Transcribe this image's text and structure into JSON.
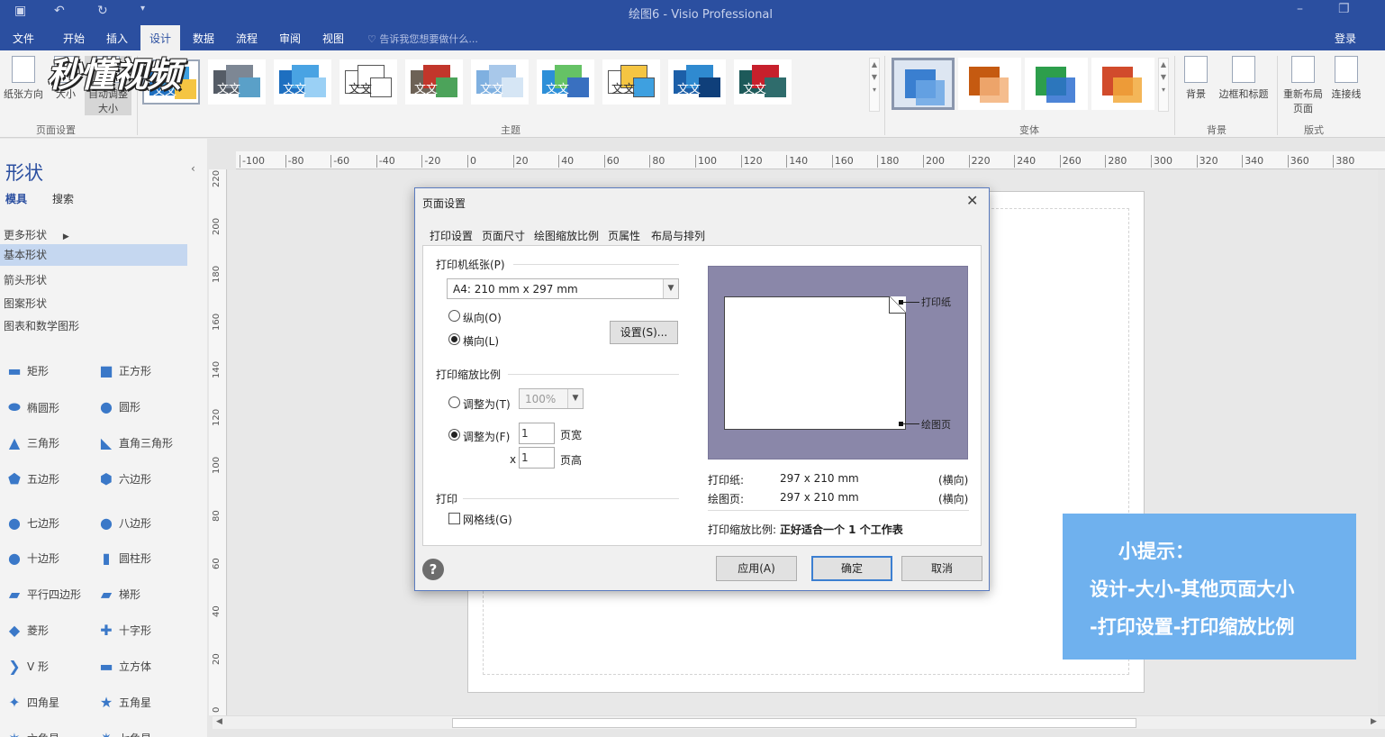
{
  "app": {
    "title": "绘图6 - Visio Professional",
    "login": "登录",
    "tell_me": "告诉我您想要做什么..."
  },
  "menu": [
    "文件",
    "开始",
    "插入",
    "设计",
    "数据",
    "流程",
    "审阅",
    "视图"
  ],
  "ribbon": {
    "page_setup": {
      "orientation": "纸张方向",
      "size": "大小",
      "autofit": "自动调整大小",
      "group": "页面设置"
    },
    "themes_group": "主题",
    "theme_text": "文文",
    "variants_group": "变体",
    "background": {
      "backgrounds": "背景",
      "borders_titles": "边框和标题",
      "group": "背景"
    },
    "layout": {
      "relayout": "重新布局页面",
      "connectors": "连接线",
      "group": "版式"
    },
    "theme_colors": [
      [
        "#1e6fc0",
        "#3ea0e0",
        "#f5c542"
      ],
      [
        "#555c66",
        "#7d8794",
        "#5aa0c8"
      ],
      [
        "#1e6fc0",
        "#49a3e3",
        "#9ad0f5"
      ],
      [
        "#ffffff",
        "#ffffff",
        "#ffffff"
      ],
      [
        "#6d6256",
        "#c2362b",
        "#4ca35a"
      ],
      [
        "#7fb0e0",
        "#a8c8ea",
        "#d6e6f5"
      ],
      [
        "#2c8fd8",
        "#65c265",
        "#3970c0"
      ],
      [
        "#ffffff",
        "#f5c542",
        "#3ea0e0"
      ],
      [
        "#1c5fa8",
        "#2f8ad0",
        "#0f3f7a"
      ],
      [
        "#1d5a5a",
        "#c7202c",
        "#2f6c6c"
      ]
    ],
    "variant_colors": [
      [
        "#3a7fd0",
        "#6ba6e5"
      ],
      [
        "#c55a11",
        "#f3b27a"
      ],
      [
        "#2d9e4c",
        "#2d6fd0"
      ],
      [
        "#d14b2c",
        "#f2a93b"
      ]
    ]
  },
  "watermark": "秒懂视频",
  "shapes_pane": {
    "title": "形状",
    "tabs": [
      "模具",
      "搜索"
    ],
    "categories": [
      "更多形状",
      "基本形状",
      "箭头形状",
      "图案形状",
      "图表和数学图形"
    ],
    "selected_category": "基本形状",
    "shapes": [
      {
        "label": "矩形",
        "glyph": "▬"
      },
      {
        "label": "正方形",
        "glyph": "■"
      },
      {
        "label": "椭圆形",
        "glyph": "⬬"
      },
      {
        "label": "圆形",
        "glyph": "●"
      },
      {
        "label": "三角形",
        "glyph": "▲"
      },
      {
        "label": "直角三角形",
        "glyph": "◣"
      },
      {
        "label": "五边形",
        "glyph": "⬟"
      },
      {
        "label": "六边形",
        "glyph": "⬢"
      },
      {
        "label": "七边形",
        "glyph": "●"
      },
      {
        "label": "八边形",
        "glyph": "●"
      },
      {
        "label": "十边形",
        "glyph": "●"
      },
      {
        "label": "圆柱形",
        "glyph": "▮"
      },
      {
        "label": "平行四边形",
        "glyph": "▰"
      },
      {
        "label": "梯形",
        "glyph": "▰"
      },
      {
        "label": "菱形",
        "glyph": "◆"
      },
      {
        "label": "十字形",
        "glyph": "✚"
      },
      {
        "label": "V 形",
        "glyph": "❯"
      },
      {
        "label": "立方体",
        "glyph": "▬"
      },
      {
        "label": "四角星",
        "glyph": "✦"
      },
      {
        "label": "五角星",
        "glyph": "★"
      },
      {
        "label": "六角星",
        "glyph": "✶"
      },
      {
        "label": "七角星",
        "glyph": "✷"
      }
    ]
  },
  "ruler": {
    "h_ticks": [
      "-100",
      "-80",
      "-60",
      "-40",
      "-20",
      "0",
      "20",
      "40",
      "60",
      "80",
      "100",
      "120",
      "140",
      "160",
      "180",
      "200",
      "220",
      "240",
      "260",
      "280",
      "300",
      "320",
      "340",
      "360",
      "380"
    ],
    "v_ticks": [
      "220",
      "200",
      "180",
      "160",
      "140",
      "120",
      "100",
      "80",
      "60",
      "40",
      "20",
      "0"
    ]
  },
  "dialog": {
    "title": "页面设置",
    "tabs": [
      "打印设置",
      "页面尺寸",
      "绘图缩放比例",
      "页属性",
      "布局与排列"
    ],
    "printer_paper_label": "打印机纸张(P)",
    "paper_value": "A4:  210 mm x 297 mm",
    "portrait": "纵向(O)",
    "landscape": "横向(L)",
    "setup_button": "设置(S)...",
    "zoom_label": "打印缩放比例",
    "adjust_to_pct": "调整为(T)",
    "pct_value": "100%",
    "fit_to": "调整为(F)",
    "fit_wide_value": "1",
    "fit_wide_unit": "页宽",
    "x_sep": "x",
    "fit_high_value": "1",
    "fit_high_unit": "页高",
    "print_label": "打印",
    "gridlines": "网格线(G)",
    "preview_paper_label": "打印纸",
    "preview_page_label": "绘图页",
    "paper_row_label": "打印纸:",
    "paper_row_value": "297 x 210 mm",
    "paper_row_orient": "(横向)",
    "page_row_label": "绘图页:",
    "page_row_value": "297 x 210 mm",
    "page_row_orient": "(横向)",
    "scale_summary_label": "打印缩放比例:",
    "scale_summary_value": "正好适合一个 1 个工作表",
    "apply": "应用(A)",
    "ok": "确定",
    "cancel": "取消",
    "help": "?"
  },
  "tip": {
    "line1": "小提示：",
    "line2": "设计-大小-其他页面大小",
    "line3": "-打印设置-打印缩放比例"
  }
}
